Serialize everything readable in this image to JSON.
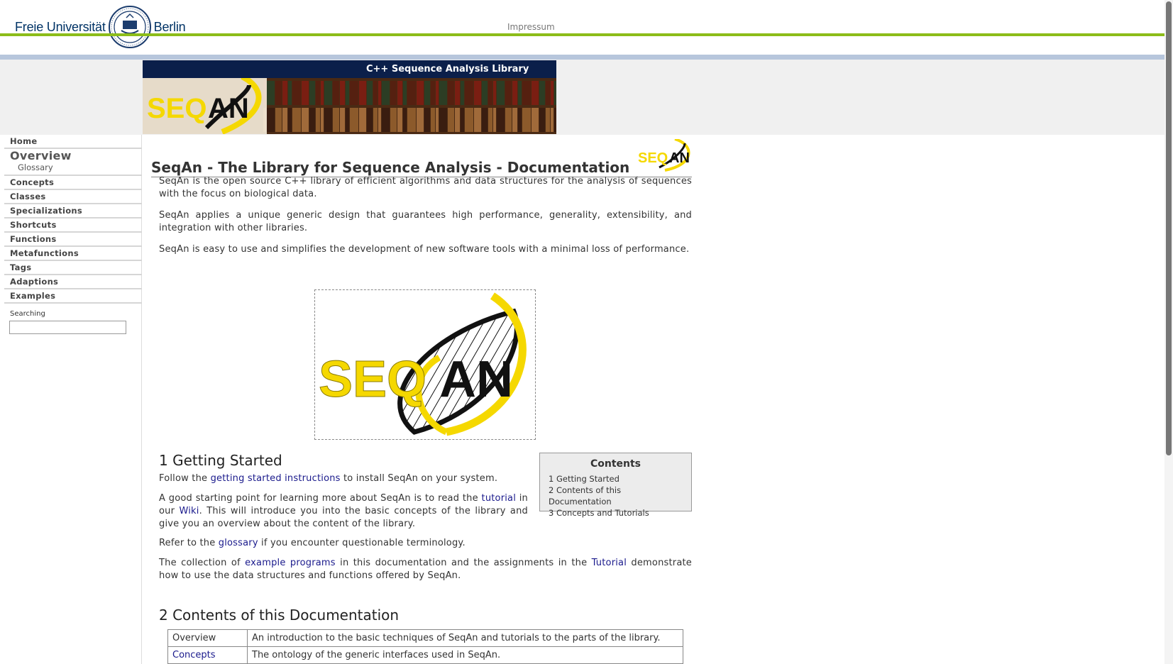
{
  "header": {
    "logo_left": "Freie Universität",
    "logo_right": "Berlin",
    "impressum": "Impressum"
  },
  "banner": {
    "title": "C++ Sequence Analysis Library",
    "logo_text": "SEQAN"
  },
  "sidebar": {
    "items": [
      {
        "label": "Home"
      },
      {
        "label": "Overview"
      },
      {
        "label": "Glossary"
      },
      {
        "label": "Concepts"
      },
      {
        "label": "Classes"
      },
      {
        "label": "Specializations"
      },
      {
        "label": "Shortcuts"
      },
      {
        "label": "Functions"
      },
      {
        "label": "Metafunctions"
      },
      {
        "label": "Tags"
      },
      {
        "label": "Adaptions"
      },
      {
        "label": "Examples"
      }
    ],
    "search_label": "Searching",
    "search_value": ""
  },
  "main": {
    "title": "SeqAn - The Library for Sequence Analysis - Documentation",
    "intro": [
      "SeqAn is the open source C++ library of efficient algorithms and data structures for the analysis of sequences with the focus on biological data.",
      "SeqAn applies a unique generic design that guarantees high performance, generality, extensibility, and integration with other libraries.",
      "SeqAn is easy to use and simplifies the development of new software tools with a minimal loss of performance."
    ],
    "section1": {
      "heading": "1 Getting Started",
      "p1_pre": "Follow the ",
      "p1_link": "getting started instructions",
      "p1_post": " to install SeqAn on your system.",
      "p2_pre": "A good starting point for learning more about SeqAn is to read the ",
      "p2_link1": "tutorial",
      "p2_mid": " in our ",
      "p2_link2": "Wiki",
      "p2_post": ". This will introduce you into the basic concepts of the library and give you an overview about the content of the library.",
      "p3_pre": "Refer to the ",
      "p3_link": "glossary",
      "p3_post": " if you encounter questionable terminology.",
      "p4_pre": "The collection of ",
      "p4_link1": "example programs",
      "p4_mid": " in this documentation and the assignments in the ",
      "p4_link2": "Tutorial",
      "p4_post": " demonstrate how to use the data structures and functions offered by SeqAn."
    },
    "contents": {
      "title": "Contents",
      "items": [
        "1 Getting Started",
        "2 Contents of this Documentation",
        "3 Concepts and Tutorials"
      ]
    },
    "section2": {
      "heading": "2 Contents of this Documentation",
      "rows": [
        {
          "name": "Overview",
          "desc": "An introduction to the basic techniques of SeqAn and tutorials to the parts of the library."
        },
        {
          "name": "Concepts",
          "desc": "The ontology of the generic interfaces used in SeqAn."
        }
      ]
    }
  },
  "colors": {
    "green_bar": "#8cbd1a",
    "blue_bar": "#b7c6dc",
    "banner_title_bg": "#0b1f4a",
    "link": "#1a1a8c",
    "logo_yellow": "#f5d800"
  }
}
